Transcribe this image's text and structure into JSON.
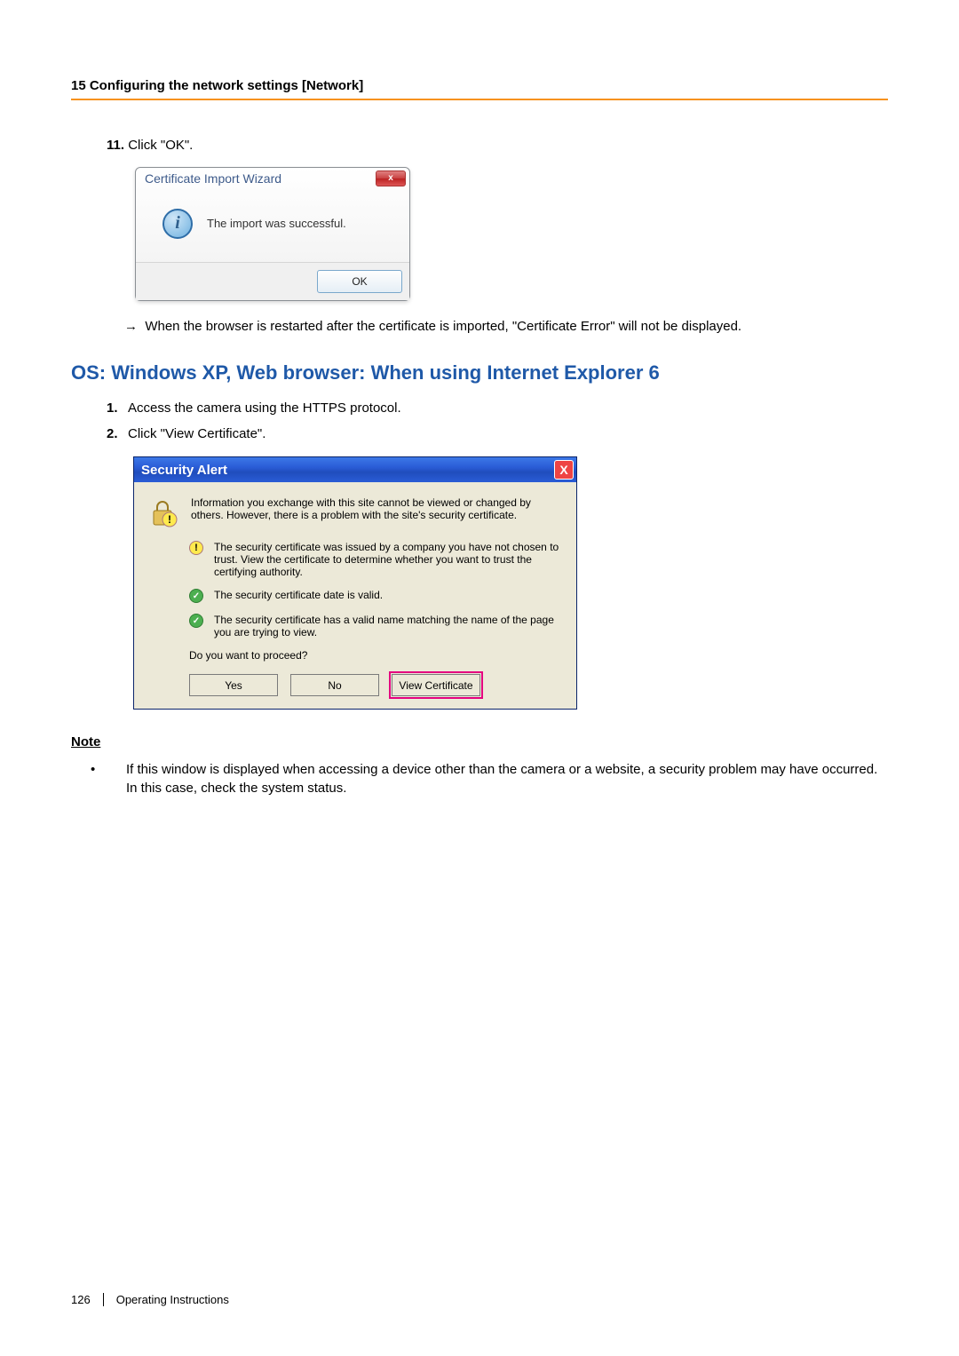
{
  "header": {
    "section": "15 Configuring the network settings [Network]"
  },
  "step11": {
    "num": "11.",
    "text": " Click \"OK\"."
  },
  "vista": {
    "title": "Certificate Import Wizard",
    "close": "x",
    "msg": "The import was successful.",
    "ok": "OK"
  },
  "arrow_line": "When the browser is restarted after the certificate is imported, \"Certificate Error\" will not be displayed.",
  "h2": "OS: Windows XP, Web browser: When using Internet Explorer 6",
  "stepsA": [
    {
      "n": "1.",
      "t": "Access the camera using the HTTPS protocol."
    },
    {
      "n": "2.",
      "t": "Click \"View Certificate\"."
    }
  ],
  "xp": {
    "title": "Security Alert",
    "close": "X",
    "intro": "Information you exchange with this site cannot be viewed or changed by others. However, there is a problem with the site's security certificate.",
    "warn": "The security certificate was issued by a company you have not chosen to trust. View the certificate to determine whether you want to trust the certifying authority.",
    "valid1": "The security certificate date is valid.",
    "valid2": "The security certificate has a valid name matching the name of the page you are trying to view.",
    "question": "Do you want to proceed?",
    "yes": "Yes",
    "no": "No",
    "view": "View Certificate"
  },
  "note": {
    "label": "Note",
    "item": "If this window is displayed when accessing a device other than the camera or a website, a security problem may have occurred. In this case, check the system status."
  },
  "footer": {
    "page": "126",
    "doc": "Operating Instructions"
  }
}
